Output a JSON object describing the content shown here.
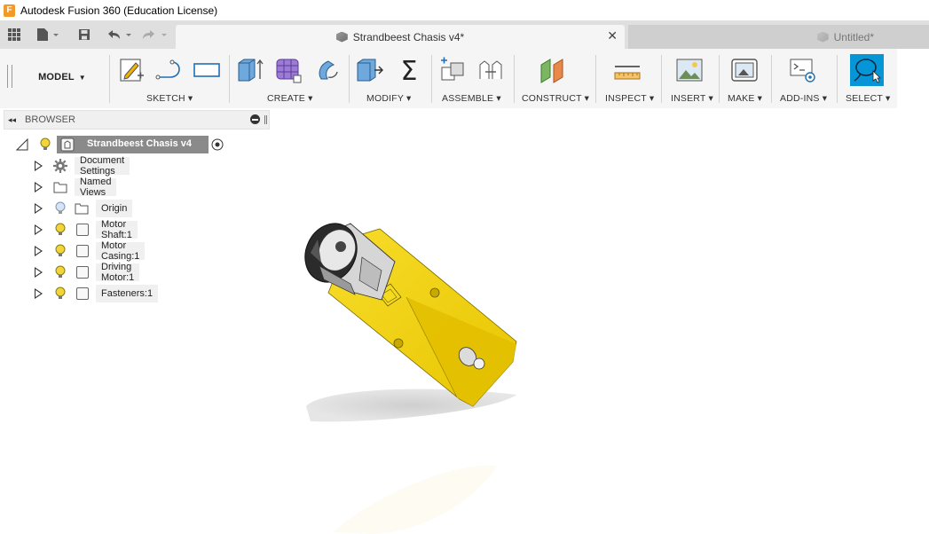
{
  "window": {
    "title": "Autodesk Fusion 360 (Education License)",
    "logo_letter": "F"
  },
  "tabs": [
    {
      "label": "Strandbeest Chasis v4*",
      "active": true
    },
    {
      "label": "Untitled*",
      "active": false
    }
  ],
  "toolbar": {
    "workspace": "MODEL",
    "groups": [
      {
        "label": "SKETCH",
        "icons": [
          "sketch-create-icon",
          "line-icon",
          "rectangle-icon"
        ]
      },
      {
        "label": "CREATE",
        "icons": [
          "extrude-icon",
          "form-icon",
          "revolve-icon"
        ]
      },
      {
        "label": "MODIFY",
        "icons": [
          "press-pull-icon",
          "parameters-icon"
        ]
      },
      {
        "label": "ASSEMBLE",
        "icons": [
          "new-component-icon",
          "joint-icon"
        ]
      },
      {
        "label": "CONSTRUCT",
        "icons": [
          "offset-plane-icon"
        ]
      },
      {
        "label": "INSPECT",
        "icons": [
          "measure-icon"
        ]
      },
      {
        "label": "INSERT",
        "icons": [
          "insert-image-icon"
        ]
      },
      {
        "label": "MAKE",
        "icons": [
          "3d-print-icon"
        ]
      },
      {
        "label": "ADD-INS",
        "icons": [
          "scripts-icon"
        ]
      },
      {
        "label": "SELECT",
        "icons": [
          "select-lasso-icon"
        ]
      }
    ]
  },
  "browser": {
    "title": "BROWSER",
    "root": "Strandbeest Chasis v4",
    "items": [
      {
        "label": "Document Settings",
        "icon": "gear-icon"
      },
      {
        "label": "Named Views",
        "icon": "folder-icon"
      },
      {
        "label": "Origin",
        "icon": "folder-icon"
      },
      {
        "label": "Motor Shaft:1",
        "icon": "component-icon"
      },
      {
        "label": "Motor Casing:1",
        "icon": "component-icon"
      },
      {
        "label": "Driving Motor:1",
        "icon": "component-icon"
      },
      {
        "label": "Fasteners:1",
        "icon": "component-icon"
      }
    ]
  },
  "colors": {
    "accent": "#0696d7",
    "model_body": "#f3d000",
    "toolbar_bg": "#f5f5f5",
    "tabbar_bg": "#dfdfdf"
  }
}
